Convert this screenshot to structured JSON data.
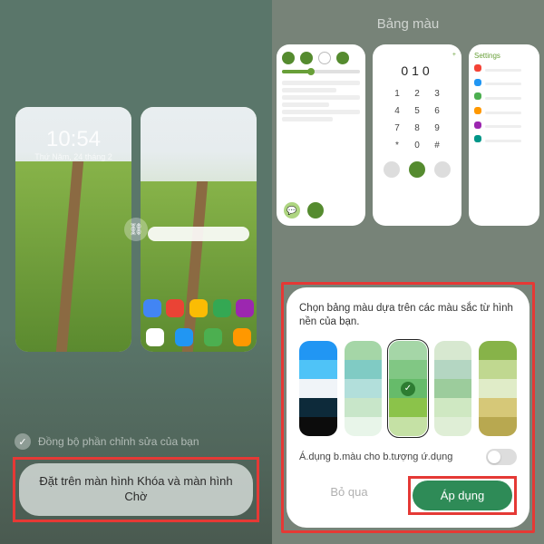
{
  "left": {
    "sync_label": "Đồng bộ phần chỉnh sửa của bạn",
    "set_button": "Đặt trên màn hình Khóa và màn hình Chờ",
    "lock_preview": {
      "time": "10:54",
      "date": "Thứ Năm, 24 tháng 2"
    }
  },
  "right": {
    "header": "Bảng màu",
    "dialer_number": "010",
    "settings_title": "Settings",
    "sheet": {
      "desc": "Chọn bảng màu dựa trên các màu sắc từ hình nền của bạn.",
      "apply_icons_label": "Á.dụng b.màu cho b.tượng ứ.dụng",
      "skip_label": "Bỏ qua",
      "apply_label": "Áp dụng",
      "palettes": [
        {
          "selected": false,
          "c": [
            "#2196f3",
            "#4fc3f7",
            "#f0f4f8",
            "#0d2a3a",
            "#0c0c0c"
          ]
        },
        {
          "selected": false,
          "c": [
            "#a5d6a7",
            "#80cbc4",
            "#b2dfdb",
            "#c8e6c9",
            "#e8f5e9"
          ]
        },
        {
          "selected": true,
          "c": [
            "#a5d6a7",
            "#81c784",
            "#66bb6a",
            "#8bc34a",
            "#c5e1a5"
          ]
        },
        {
          "selected": false,
          "c": [
            "#d7e8d0",
            "#b4d6c2",
            "#9ccc9c",
            "#cfe8c2",
            "#dfeed6"
          ]
        },
        {
          "selected": false,
          "c": [
            "#87b349",
            "#c0d890",
            "#e0ecc8",
            "#d6c878",
            "#b8a850"
          ]
        }
      ]
    }
  }
}
